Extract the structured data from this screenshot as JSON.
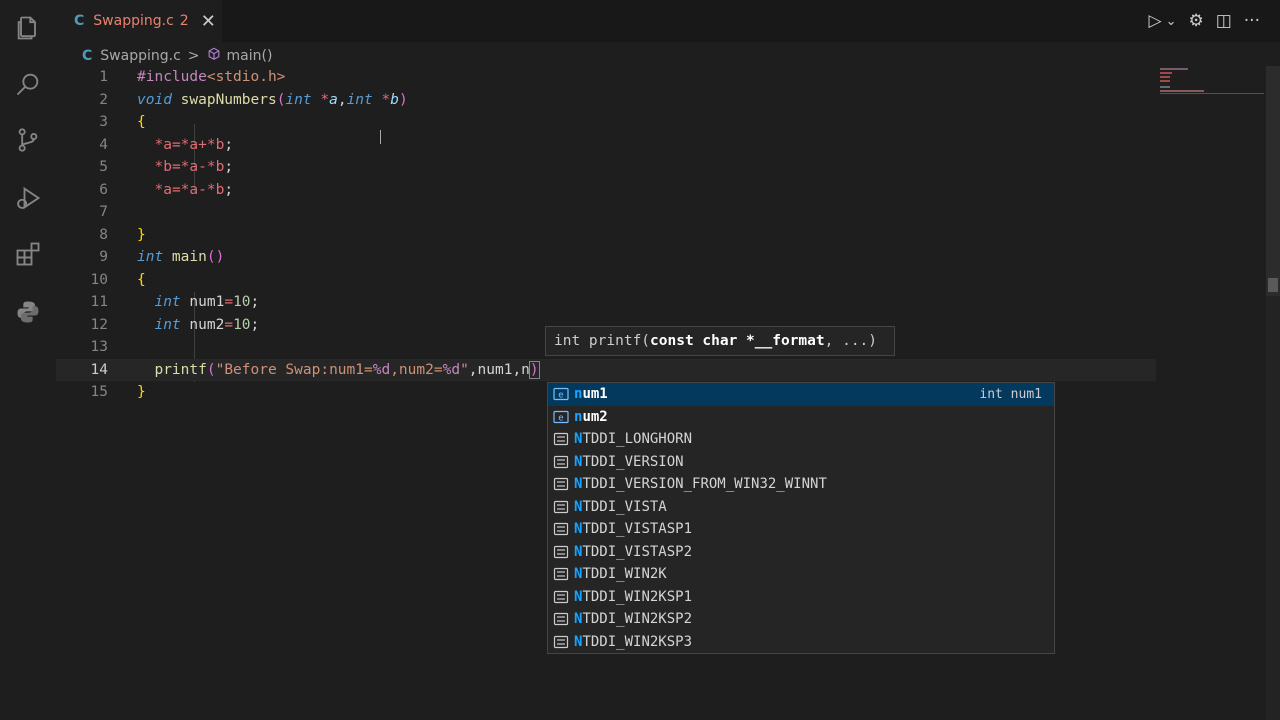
{
  "activity_bar": {
    "icons": [
      "explorer-icon",
      "search-icon",
      "source-control-icon",
      "run-debug-icon",
      "extensions-icon",
      "python-icon"
    ]
  },
  "tab": {
    "lang_badge": "C",
    "filename": "Swapping.c",
    "problem_count": "2",
    "close_glyph": "✕"
  },
  "top_actions": {
    "run_glyph": "▷",
    "dropdown_glyph": "⌄",
    "gear_glyph": "⚙",
    "split_glyph": "◫",
    "more_glyph": "···"
  },
  "breadcrumb": {
    "lang_badge": "C",
    "file": "Swapping.c",
    "separator": ">",
    "symbol": "main()"
  },
  "editor": {
    "line_numbers": [
      "1",
      "2",
      "3",
      "4",
      "5",
      "6",
      "7",
      "8",
      "9",
      "10",
      "11",
      "12",
      "13",
      "14",
      "15"
    ],
    "active_line": "14",
    "lines": {
      "l1": {
        "hash_include": "#include",
        "header": "<stdio.h>"
      },
      "l2": {
        "void": "void",
        "name": "swapNumbers",
        "open": "(",
        "int1": "int",
        "star1": " *",
        "a": "a",
        "comma": ",",
        "int2": "int",
        "star2": " *",
        "b": "b",
        "close": ")"
      },
      "l3": {
        "brace": "{"
      },
      "l4": {
        "text_star_a": "*a",
        "eq": "=",
        "s1": "*a",
        "plus": "+",
        "s2": "*b",
        "semi": ";"
      },
      "l5": {
        "text_star_b": "*b",
        "eq": "=",
        "s1": "*a",
        "minus": "-",
        "s2": "*b",
        "semi": ";"
      },
      "l6": {
        "text_star_a": "*a",
        "eq": "=",
        "s1": "*a",
        "minus": "-",
        "s2": "*b",
        "semi": ";"
      },
      "l8": {
        "brace": "}"
      },
      "l9": {
        "int": "int",
        "name": " main",
        "parens": "()"
      },
      "l10": {
        "brace": "{"
      },
      "l11": {
        "int": "int",
        "var": " num1",
        "eq": "=",
        "val": "10",
        "semi": ";"
      },
      "l12": {
        "int": "int",
        "var": " num2",
        "eq": "=",
        "val": "10",
        "semi": ";"
      },
      "l14": {
        "fn": "printf",
        "open": "(",
        "str1": "\"Before Swap:num1=",
        "fmt1": "%d",
        "str2": ",num2=",
        "fmt2": "%d",
        "str3": "\"",
        "rest": ",num1,n",
        "close": ")"
      },
      "l15": {
        "brace": "}"
      }
    }
  },
  "signature_hint": {
    "prefix": "int printf(",
    "bold_param": "const char *__format",
    "suffix": ", ...)"
  },
  "suggestions": {
    "items": [
      {
        "label_match": "n",
        "label_rest": "um1",
        "kind": "variable",
        "detail": "int num1"
      },
      {
        "label_match": "n",
        "label_rest": "um2",
        "kind": "variable",
        "detail": ""
      },
      {
        "label_match": "N",
        "label_rest": "TDDI_LONGHORN",
        "kind": "constant",
        "detail": ""
      },
      {
        "label_match": "N",
        "label_rest": "TDDI_VERSION",
        "kind": "constant",
        "detail": ""
      },
      {
        "label_match": "N",
        "label_rest": "TDDI_VERSION_FROM_WIN32_WINNT",
        "kind": "constant",
        "detail": ""
      },
      {
        "label_match": "N",
        "label_rest": "TDDI_VISTA",
        "kind": "constant",
        "detail": ""
      },
      {
        "label_match": "N",
        "label_rest": "TDDI_VISTASP1",
        "kind": "constant",
        "detail": ""
      },
      {
        "label_match": "N",
        "label_rest": "TDDI_VISTASP2",
        "kind": "constant",
        "detail": ""
      },
      {
        "label_match": "N",
        "label_rest": "TDDI_WIN2K",
        "kind": "constant",
        "detail": ""
      },
      {
        "label_match": "N",
        "label_rest": "TDDI_WIN2KSP1",
        "kind": "constant",
        "detail": ""
      },
      {
        "label_match": "N",
        "label_rest": "TDDI_WIN2KSP2",
        "kind": "constant",
        "detail": ""
      },
      {
        "label_match": "N",
        "label_rest": "TDDI_WIN2KSP3",
        "kind": "constant",
        "detail": ""
      }
    ],
    "selected_index": 0
  },
  "colors": {
    "background": "#1e1e1e",
    "keyword": "#569cd6",
    "function": "#dcdcaa",
    "string": "#ce9178",
    "number": "#b5cea8",
    "error_tab": "#e8826e",
    "match_highlight": "#18a3ff"
  }
}
